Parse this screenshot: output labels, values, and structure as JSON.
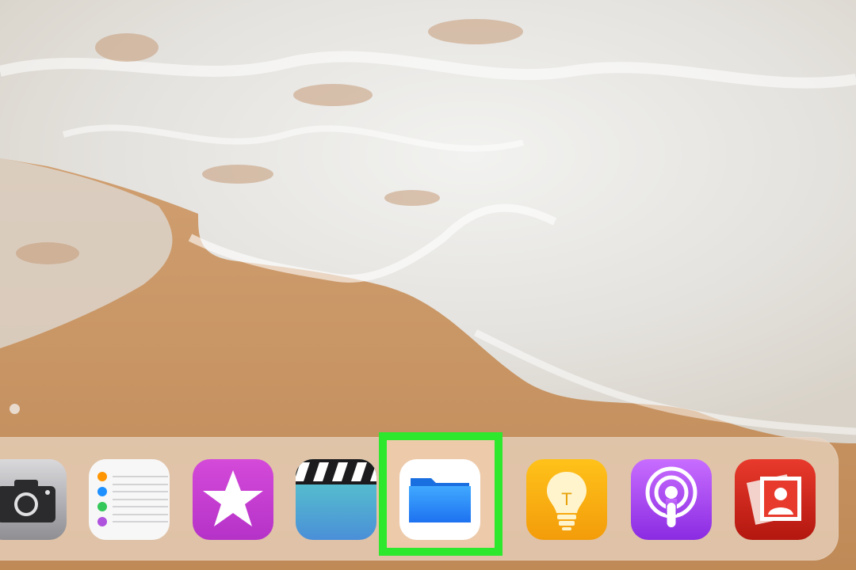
{
  "home_screen": {
    "page_indicator_count": 1
  },
  "highlight": {
    "color": "#2EE82E",
    "target": "files"
  },
  "dock": {
    "apps": [
      {
        "id": "camera",
        "icon": "camera-icon"
      },
      {
        "id": "reminders",
        "icon": "reminders-icon"
      },
      {
        "id": "itunes-store",
        "icon": "star-icon"
      },
      {
        "id": "clips",
        "icon": "clapperboard-icon"
      },
      {
        "id": "files",
        "icon": "folder-icon"
      },
      {
        "id": "tips",
        "icon": "lightbulb-icon",
        "glyph": "T"
      },
      {
        "id": "podcasts",
        "icon": "podcast-icon"
      },
      {
        "id": "photo-booth",
        "icon": "photos-icon"
      }
    ]
  }
}
